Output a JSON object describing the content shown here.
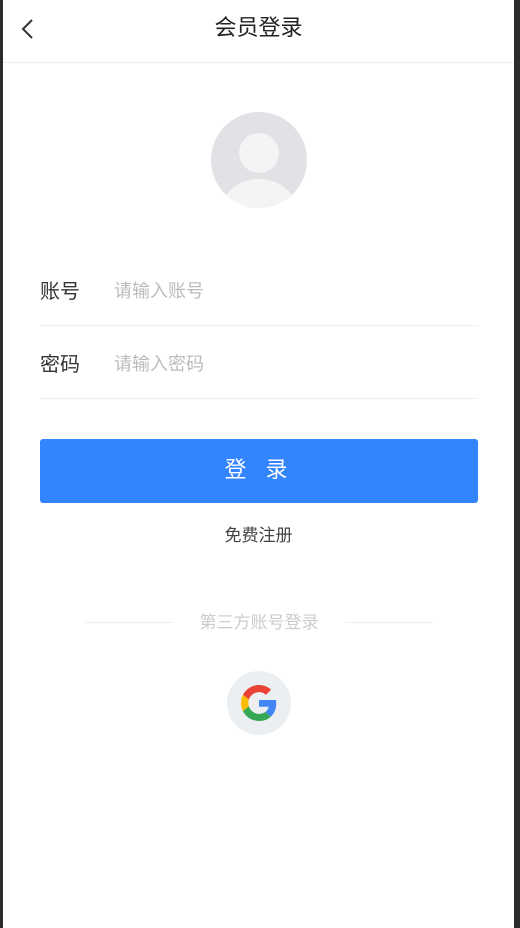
{
  "header": {
    "title": "会员登录",
    "back_icon": "chevron-left-icon"
  },
  "avatar": {
    "icon": "default-avatar-icon"
  },
  "form": {
    "account_label": "账号",
    "account_placeholder": "请输入账号",
    "account_value": "",
    "password_label": "密码",
    "password_placeholder": "请输入密码",
    "password_value": ""
  },
  "actions": {
    "login_label": "登 录",
    "register_label": "免费注册"
  },
  "third_party": {
    "divider_label": "第三方账号登录",
    "providers": [
      {
        "icon": "google-icon"
      }
    ]
  },
  "colors": {
    "accent": "#3385ff",
    "avatar_bg": "#e0e2e5",
    "divider": "#eeeeee"
  }
}
